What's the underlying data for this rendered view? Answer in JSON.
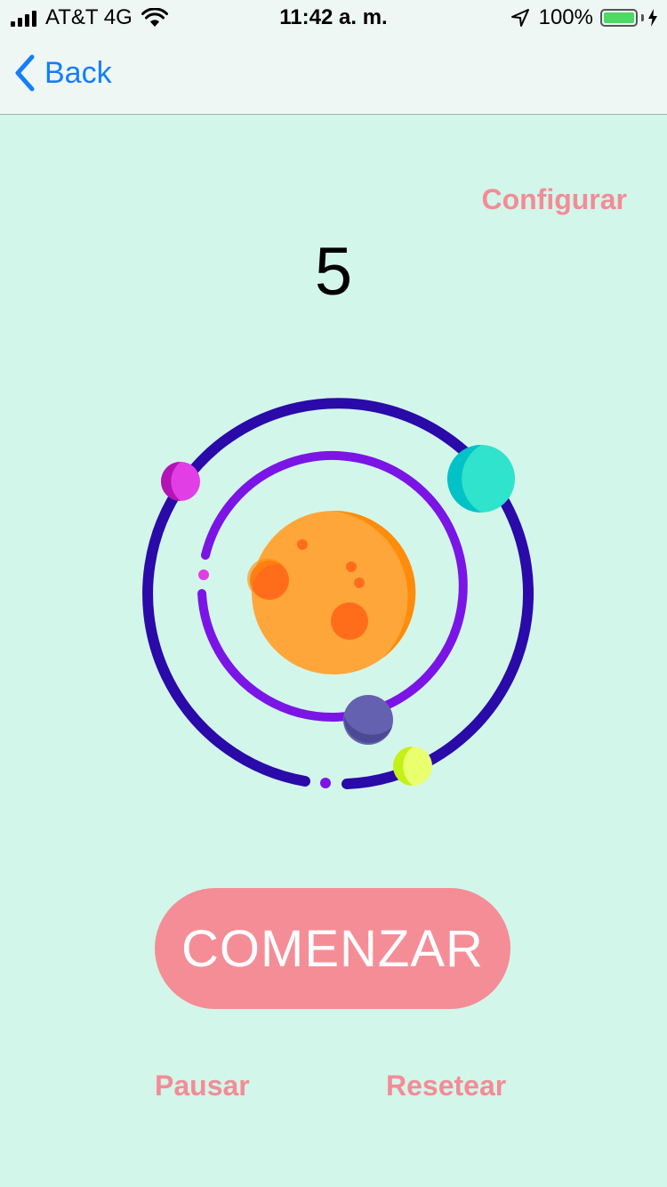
{
  "status_bar": {
    "carrier": "AT&T 4G",
    "time": "11:42 a. m.",
    "battery_percent": "100%",
    "battery_level": 1.0,
    "icons": [
      "signal-icon",
      "wifi-icon",
      "location-icon",
      "battery-icon",
      "charging-bolt-icon"
    ]
  },
  "nav": {
    "back_label": "Back",
    "back_icon": "chevron-left-icon"
  },
  "actions": {
    "configure_label": "Configurar"
  },
  "timer": {
    "count": "5"
  },
  "illustration": {
    "name": "solar-system-illustration",
    "colors": {
      "outer_orbit": "#2a0aa8",
      "inner_orbit": "#7b15e6",
      "sun": "#ffa63a",
      "sun_shade": "#ff8c0a",
      "craters": "#ff6d1b",
      "planet_pink": "#e23ee6",
      "planet_teal": "#2fe3cc",
      "planet_slate": "#6461b0",
      "planet_lime": "#e9ff6e"
    }
  },
  "controls": {
    "start_label": "COMENZAR",
    "pause_label": "Pausar",
    "reset_label": "Resetear"
  },
  "colors": {
    "background": "#d3f6ea",
    "accent": "#f58d97",
    "link_blue": "#147efb"
  }
}
